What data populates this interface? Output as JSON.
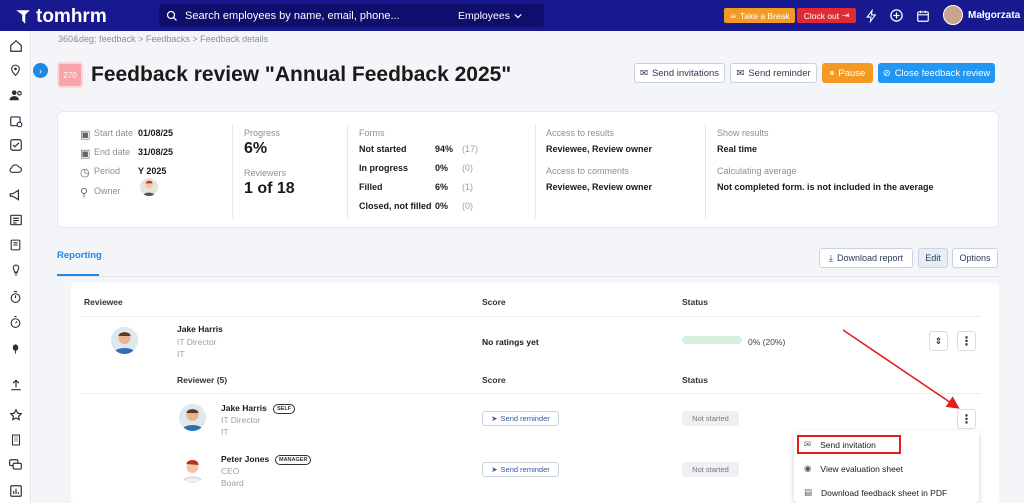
{
  "topbar": {
    "brand": "tomhrm",
    "search_placeholder": "Search employees by name, email, phone...",
    "search_scope": "Employees",
    "take_break": "Take a Break",
    "clock_out": "Clock out",
    "user_name": "Małgorzata"
  },
  "breadcrumb": "360&deg; feedback > Feedbacks > Feedback details",
  "header": {
    "id_badge": "270",
    "title": "Feedback review \"Annual Feedback 2025\"",
    "send_invitations": "Send invitations",
    "send_reminder": "Send reminder",
    "pause": "Pause",
    "close_review": "Close feedback review"
  },
  "info": {
    "start_date_label": "Start date",
    "start_date": "01/08/25",
    "end_date_label": "End date",
    "end_date": "31/08/25",
    "period_label": "Period",
    "period": "Y 2025",
    "owner_label": "Owner",
    "progress_label": "Progress",
    "progress": "6%",
    "reviewers_label": "Reviewers",
    "reviewers": "1 of 18",
    "forms_label": "Forms",
    "forms": [
      {
        "label": "Not started",
        "pct": "94%",
        "count": "(17)"
      },
      {
        "label": "In progress",
        "pct": "0%",
        "count": "(0)"
      },
      {
        "label": "Filled",
        "pct": "6%",
        "count": "(1)"
      },
      {
        "label": "Closed, not filled",
        "pct": "0%",
        "count": "(0)"
      }
    ],
    "access_results_label": "Access to results",
    "access_results": "Reviewee, Review owner",
    "access_comments_label": "Access to comments",
    "access_comments": "Reviewee, Review owner",
    "show_results_label": "Show results",
    "show_results": "Real time",
    "calc_avg_label": "Calculating average",
    "calc_avg": "Not completed form. is not included in the average"
  },
  "reporting": {
    "tab": "Reporting",
    "download_report": "Download report",
    "edit": "Edit",
    "options": "Options",
    "col_reviewee": "Reviewee",
    "col_score": "Score",
    "col_status": "Status",
    "reviewee": {
      "name": "Jake Harris",
      "title": "IT Director",
      "dept": "IT",
      "score": "No ratings yet",
      "status": "0%  (20%)",
      "progress": 0
    },
    "reviewer_header": "Reviewer (5)",
    "reviewers": [
      {
        "name": "Jake Harris",
        "tag": "SELF",
        "title": "IT Director",
        "dept": "IT",
        "action": "Send reminder",
        "status": "Not started"
      },
      {
        "name": "Peter Jones",
        "tag": "MANAGER",
        "title": "CEO",
        "dept": "Board",
        "action": "Send reminder",
        "status": "Not started"
      }
    ]
  },
  "context_menu": {
    "items": [
      "Send invitation",
      "View evaluation sheet",
      "Download feedback sheet in PDF"
    ]
  },
  "colors": {
    "brand": "#18188f",
    "accent": "#2196f3",
    "orange": "#f39a25",
    "red": "#e02b36",
    "annotation": "#e02020"
  }
}
